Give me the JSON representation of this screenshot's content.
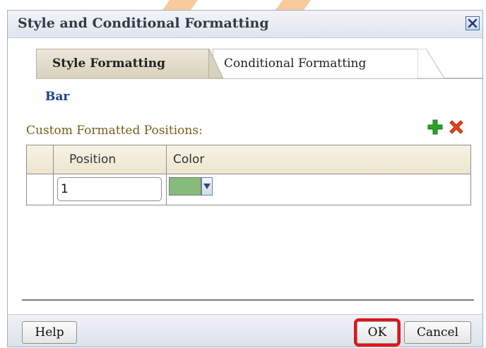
{
  "dialog": {
    "title": "Style and Conditional Formatting",
    "close_icon": "close-icon"
  },
  "tabs": [
    {
      "label": "Style Formatting",
      "active": true
    },
    {
      "label": "Conditional Formatting",
      "active": false
    }
  ],
  "section": {
    "heading": "Bar",
    "custom_label": "Custom Formatted Positions:",
    "add_icon": "plus-icon",
    "delete_icon": "delete-x-icon"
  },
  "table": {
    "headers": {
      "position": "Position",
      "color": "Color"
    },
    "rows": [
      {
        "position": "1",
        "color": "#86bb7a"
      }
    ]
  },
  "footer": {
    "help_label": "Help",
    "ok_label": "OK",
    "cancel_label": "Cancel",
    "ok_highlight_color": "#e3131b"
  },
  "colors": {
    "title_text": "#333a44",
    "section_heading": "#1c3f8f",
    "label_text": "#7a5c1c",
    "swatch_green": "#86bb7a"
  }
}
